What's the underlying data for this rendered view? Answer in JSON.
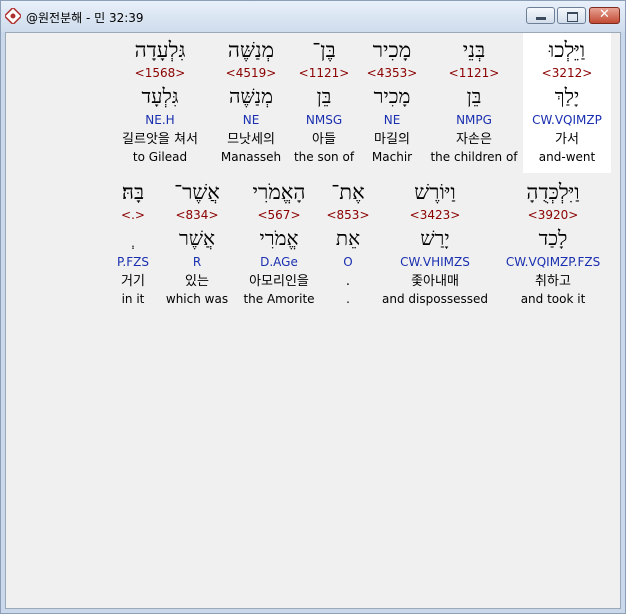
{
  "window": {
    "title": "@원전분해 - 민 32:39"
  },
  "rows": [
    [
      {
        "heb": "וַיֵּלְכוּ",
        "strong": "<3212>",
        "lemma": "יָלַךְ",
        "morph": "CW.VQIMZP",
        "kor": "가서",
        "eng": "and-went"
      },
      {
        "heb": "בְּנֵי",
        "strong": "<1121>",
        "lemma": "בֵּן",
        "morph": "NMPG",
        "kor": "자손은",
        "eng": "the children of"
      },
      {
        "heb": "מָכִיר",
        "strong": "<4353>",
        "lemma": "מָכִיר",
        "morph": "NE",
        "kor": "마길의",
        "eng": "Machir"
      },
      {
        "heb": "בֶּן־",
        "strong": "<1121>",
        "lemma": "בֵּן",
        "morph": "NMSG",
        "kor": "아들",
        "eng": "the son of"
      },
      {
        "heb": "מְנַשֶּׁה",
        "strong": "<4519>",
        "lemma": "מְנַשֶּׁה",
        "morph": "NE",
        "kor": "므낫세의",
        "eng": "Manasseh"
      },
      {
        "heb": "גִּלְעָדָה",
        "strong": "<1568>",
        "lemma": "גִּלְעָד",
        "morph": "NE.H",
        "kor": "길르앗을 쳐서",
        "eng": "to Gilead"
      }
    ],
    [
      {
        "heb": "וַיִּלְכְּדֻהָ",
        "strong": "<3920>",
        "lemma": "לָכַד",
        "morph": "CW.VQIMZP.FZS",
        "kor": "취하고",
        "eng": "and took it"
      },
      {
        "heb": "וַיּוֹרֶשׁ",
        "strong": "<3423>",
        "lemma": "יָרַשׁ",
        "morph": "CW.VHIMZS",
        "kor": "좇아내매",
        "eng": "and dispossessed"
      },
      {
        "heb": "אֶת־",
        "strong": "<853>",
        "lemma": "אֵת",
        "morph": "O",
        "kor": ".",
        "eng": "."
      },
      {
        "heb": "הָאֱמֹרִי",
        "strong": "<567>",
        "lemma": "אֱמֹרִי",
        "morph": "D.AGe",
        "kor": "아모리인을",
        "eng": "the Amorite"
      },
      {
        "heb": "אֲשֶׁר־",
        "strong": "<834>",
        "lemma": "אֲשֶׁר",
        "morph": "R",
        "kor": "있는",
        "eng": "which was"
      },
      {
        "heb": "בָּהּ׃",
        "strong": "<.>",
        "lemma": "ְ",
        "morph": "P.FZS",
        "kor": "거기",
        "eng": "in it"
      }
    ]
  ]
}
